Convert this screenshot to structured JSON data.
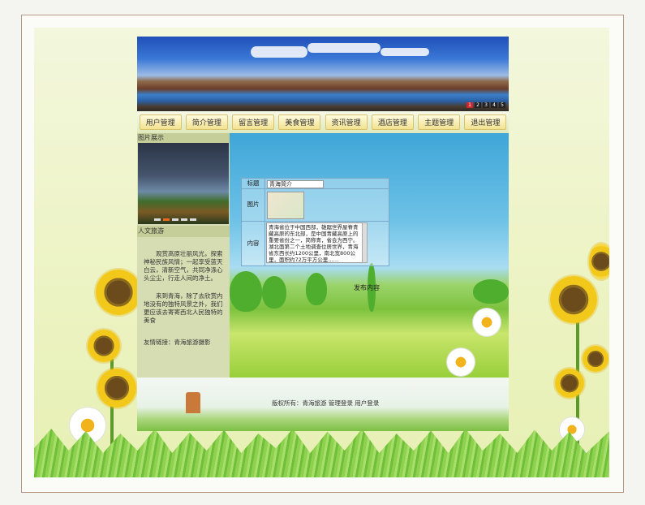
{
  "nav": {
    "items": [
      "用户管理",
      "简介管理",
      "留言管理",
      "美食管理",
      "资讯管理",
      "酒店管理",
      "主题管理",
      "退出管理"
    ]
  },
  "banner": {
    "dots": [
      "1",
      "2",
      "3",
      "4",
      "5"
    ]
  },
  "sidebar": {
    "photo_title": "图片展示",
    "tour_title": "人文旅游",
    "paragraph1": "观赏高原壮丽风光，探索神秘民族风情；一起享受蓝天白云，清新空气，共同净涤心头尘尘，行走人间的净土。",
    "paragraph2": "来到青海，除了去欣赏内地没有的独特风景之外，我们更应该去寄寄西北人民独特的美食",
    "links": "友情链接：青海旅游摄影"
  },
  "form": {
    "title_label": "标题",
    "title_value": "青海简介",
    "image_label": "图片",
    "content_label": "内容",
    "content_value": "青海省位于中国西部，雄踞世界屋脊青藏高原的东北部，是中国青藏高原上的重要省份之一，简称青，省会为西宁。湖北面第二个土地调查位居世界，青海省东西长约1200公里，南北宽800公里，面积约72万平方公里……"
  },
  "submit_label": "发布内容",
  "footer": {
    "copyright": "版权所有：青海旅游 管理登录 用户登录"
  },
  "colors": {
    "background": "#eef4c8",
    "sky": "#6cc1e6",
    "grass": "#7dc23e",
    "nav_button": "#f2e290"
  }
}
